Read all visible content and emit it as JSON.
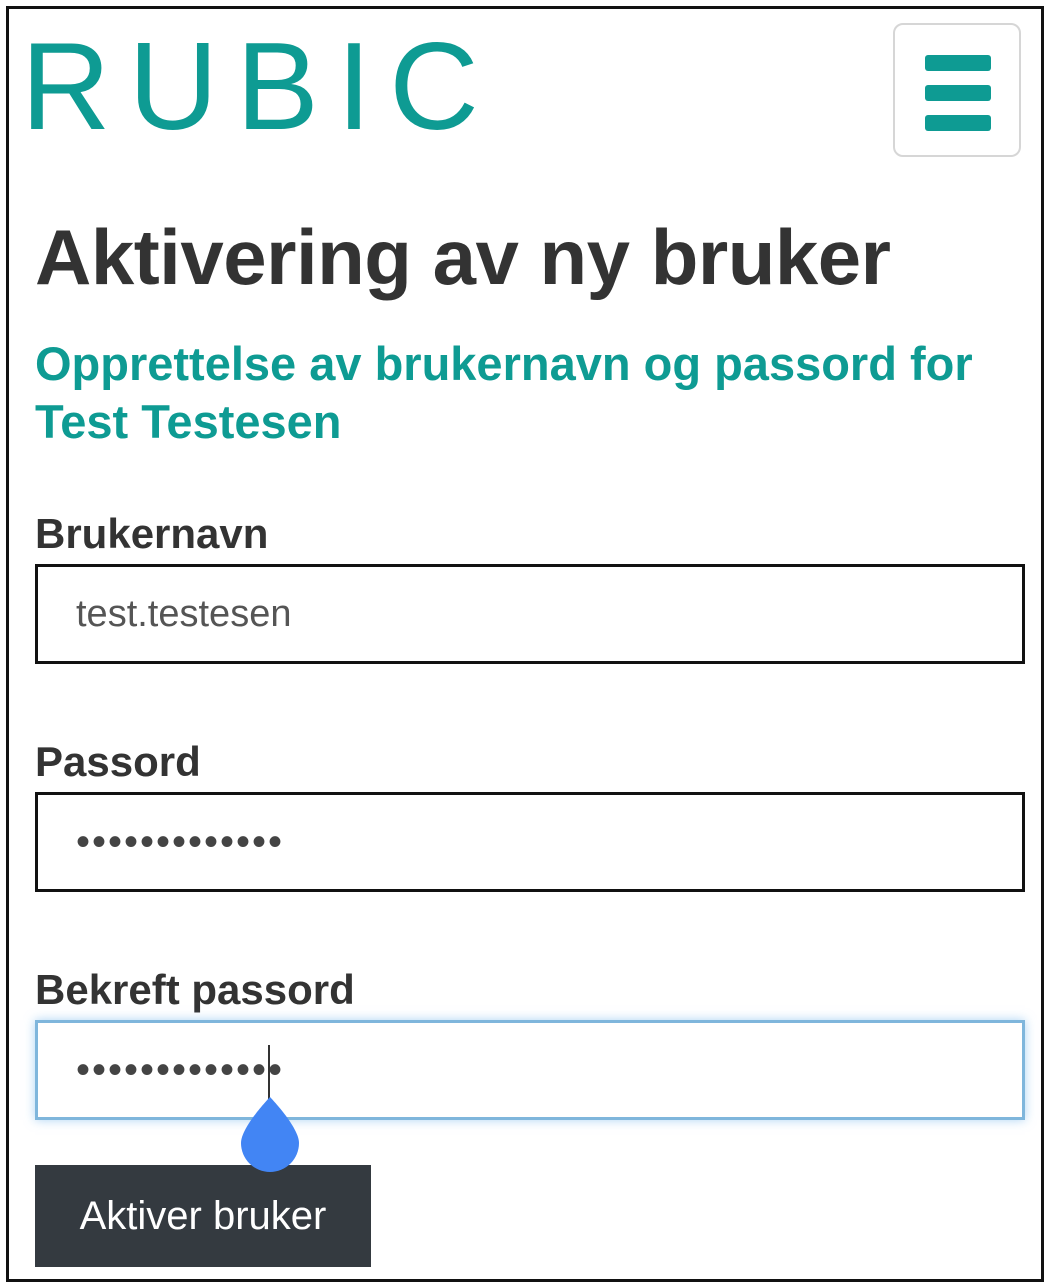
{
  "colors": {
    "brand": "#0e9b93",
    "button_bg": "#343a40",
    "focus_border": "#7fb6dc"
  },
  "header": {
    "logo_text": "RUBIC",
    "menu_icon": "hamburger-menu-icon"
  },
  "page": {
    "title": "Aktivering av ny bruker",
    "subtitle": "Opprettelse av brukernavn og passord for Test Testesen"
  },
  "form": {
    "username": {
      "label": "Brukernavn",
      "value": "test.testesen"
    },
    "password": {
      "label": "Passord",
      "value": "•••••••••••••"
    },
    "confirm_password": {
      "label": "Bekreft passord",
      "value": "•••••••••••••"
    },
    "submit_label": "Aktiver bruker"
  }
}
